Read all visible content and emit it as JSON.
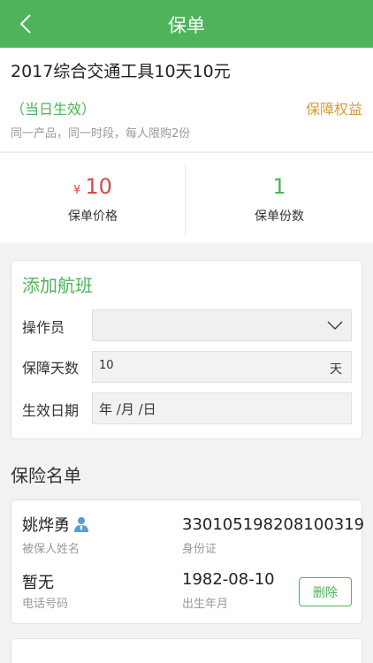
{
  "header": {
    "title": "保单",
    "back_icon": "chevron-left-icon"
  },
  "product": {
    "name": "2017综合交通工具10天10元",
    "effect": "（当日生效）",
    "rights_link": "保障权益",
    "limit_note": "同一产品，同一时段，每人限购2份"
  },
  "stats": {
    "currency": "¥",
    "price": "10",
    "price_label": "保单价格",
    "count": "1",
    "count_label": "保单份数"
  },
  "flight": {
    "title": "添加航班",
    "operator_label": "操作员",
    "operator_value": "",
    "days_label": "保障天数",
    "days_value": "10",
    "days_unit": "天",
    "date_label": "生效日期",
    "date_placeholder": "年 /月 /日"
  },
  "insured": {
    "heading": "保险名单",
    "items": [
      {
        "name": "姚烨勇",
        "name_label": "被保人姓名",
        "id_number": "330105198208100319",
        "id_label": "身份证",
        "phone": "暂无",
        "phone_label": "电话号码",
        "birth": "1982-08-10",
        "birth_label": "出生年月",
        "delete_label": "删除"
      }
    ]
  },
  "colors": {
    "brand_green": "#4fb35a",
    "price_red": "#d54a4a",
    "link_orange": "#d99a3a"
  }
}
